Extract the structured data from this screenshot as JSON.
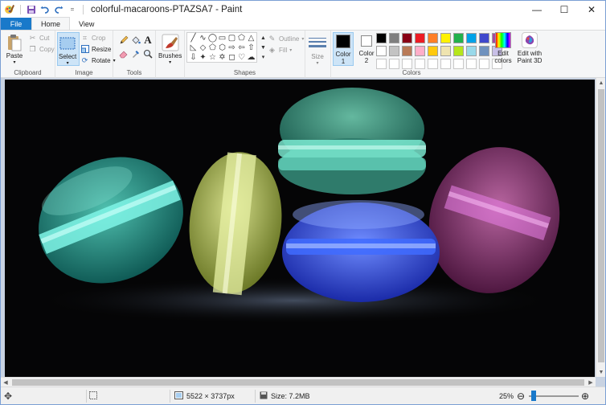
{
  "window": {
    "title": "colorful-macaroons-PTAZSA7 - Paint",
    "controls": {
      "minimize": "—",
      "maximize": "☐",
      "close": "✕"
    }
  },
  "quick_access": [
    "save-icon",
    "undo-icon",
    "redo-icon",
    "customize-icon"
  ],
  "tabs": {
    "file": "File",
    "home": "Home",
    "view": "View"
  },
  "ribbon": {
    "clipboard": {
      "label": "Clipboard",
      "paste": "Paste",
      "cut": "Cut",
      "copy": "Copy"
    },
    "image": {
      "label": "Image",
      "select": "Select",
      "crop": "Crop",
      "resize": "Resize",
      "rotate": "Rotate"
    },
    "tools": {
      "label": "Tools"
    },
    "brushes": {
      "label": "Brushes"
    },
    "shapes": {
      "label": "Shapes",
      "outline": "Outline",
      "fill": "Fill"
    },
    "size": {
      "label": "Size"
    },
    "colors": {
      "label": "Colors",
      "color1": "Color 1",
      "color2": "Color 2",
      "edit_colors": "Edit colors",
      "edit_3d": "Edit with Paint 3D",
      "color1_value": "#000000",
      "color2_value": "#ffffff",
      "palette": [
        "#000000",
        "#7f7f7f",
        "#880015",
        "#ed1c24",
        "#ff7f27",
        "#fff200",
        "#22b14c",
        "#00a2e8",
        "#3f48cc",
        "#a349a4",
        "#ffffff",
        "#c3c3c3",
        "#b97a57",
        "#ffaec9",
        "#ffc90e",
        "#efe4b0",
        "#b5e61d",
        "#99d9ea",
        "#7092be",
        "#c8bfe7",
        "#ffffff",
        "#ffffff",
        "#ffffff",
        "#ffffff",
        "#ffffff",
        "#ffffff",
        "#ffffff",
        "#ffffff",
        "#ffffff",
        "#ffffff"
      ]
    }
  },
  "status": {
    "dimensions": "5522 × 3737px",
    "size": "Size: 7.2MB",
    "zoom": "25%",
    "zoom_level": 0.25
  }
}
